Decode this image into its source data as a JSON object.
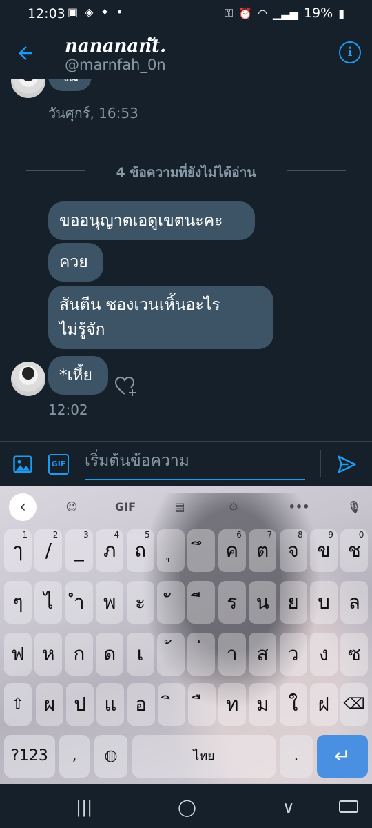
{
  "status_bar": {
    "time": "12:03",
    "battery": "19%"
  },
  "header": {
    "title": "nanananัt.",
    "handle": "@marnfah_0n"
  },
  "chat": {
    "partial_bubble": "ไม่",
    "friday_time": "วันศุกร์, 16:53",
    "unread_divider": "4 ข้อความที่ยังไม่ได้อ่าน",
    "messages": [
      {
        "text": "ขออนุญาตเอดูเขตนะคะ"
      },
      {
        "text": "ควย"
      },
      {
        "text": "สันตีน ซองเวนเหิ้นอะไร\nไม่รู้จัก"
      },
      {
        "text": "*เหี้ย"
      }
    ],
    "last_time": "12:02"
  },
  "compose": {
    "placeholder": "เริ่มต้นข้อความ",
    "gif_label": "GIF"
  },
  "keyboard": {
    "toolbar": {
      "gif": "GIF",
      "more": "•••"
    },
    "row1": [
      {
        "k": "ๅ",
        "sup": "1"
      },
      {
        "k": "/",
        "sup": "2"
      },
      {
        "k": "_",
        "sup": "3"
      },
      {
        "k": "ภ",
        "sup": "4"
      },
      {
        "k": "ถ",
        "sup": "5"
      },
      {
        "k": "ุ",
        "sup": ""
      },
      {
        "k": "ึ",
        "sup": ""
      },
      {
        "k": "ค",
        "sup": "6"
      },
      {
        "k": "ต",
        "sup": "7"
      },
      {
        "k": "จ",
        "sup": "8"
      },
      {
        "k": "ข",
        "sup": "9"
      },
      {
        "k": "ช",
        "sup": "0"
      }
    ],
    "row2": [
      "ๆ",
      "ไ",
      "ำ",
      "พ",
      "ะ",
      "ั",
      "ี",
      "ร",
      "น",
      "ย",
      "บ",
      "ล"
    ],
    "row3": [
      "ฟ",
      "ห",
      "ก",
      "ด",
      "เ",
      "้",
      "่",
      "า",
      "ส",
      "ว",
      "ง",
      "ซ"
    ],
    "row4": [
      "ผ",
      "ป",
      "แ",
      "อ",
      "ิ",
      "ื",
      "ท",
      "ม",
      "ใ",
      "ฝ"
    ],
    "symbols_key": "?123",
    "comma_key": ",",
    "space_label": "ไทย",
    "period_key": "."
  }
}
